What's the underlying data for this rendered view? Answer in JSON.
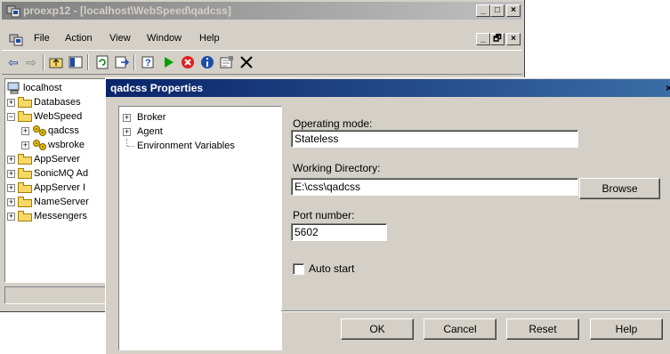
{
  "main_window": {
    "title": "proexp12 - [localhost\\WebSpeed\\qadcss]",
    "menu": [
      "File",
      "Action",
      "View",
      "Window",
      "Help"
    ],
    "caption_buttons": [
      "_",
      "□",
      "×"
    ],
    "mdi_buttons": [
      "_",
      "🗗",
      "×"
    ],
    "toolbar_icons": [
      "back-icon",
      "forward-icon",
      "up-folder-icon",
      "show-hide-tree-icon",
      "refresh-icon",
      "export-icon",
      "help-icon",
      "start-icon",
      "stop-icon",
      "info-icon",
      "properties-icon",
      "delete-icon"
    ]
  },
  "tree": {
    "items": [
      {
        "label": "localhost",
        "icon": "computer-icon"
      },
      {
        "label": "Databases",
        "icon": "folder-icon"
      },
      {
        "label": "WebSpeed",
        "icon": "folder-icon"
      },
      {
        "label": "qadcss",
        "icon": "broker-icon"
      },
      {
        "label": "wsbroke",
        "icon": "broker-icon"
      },
      {
        "label": "AppServer",
        "icon": "folder-icon"
      },
      {
        "label": "SonicMQ Ad",
        "icon": "folder-icon"
      },
      {
        "label": "AppServer I",
        "icon": "folder-icon"
      },
      {
        "label": "NameServer",
        "icon": "folder-icon"
      },
      {
        "label": "Messengers",
        "icon": "folder-icon"
      }
    ]
  },
  "dialog": {
    "title": "qadcss Properties",
    "close": "×",
    "tree": [
      "Broker",
      "Agent",
      "Environment Variables"
    ],
    "operating_mode_label": "Operating mode:",
    "operating_mode_value": "Stateless",
    "working_dir_label": "Working Directory:",
    "working_dir_value": "E:\\css\\qadcss",
    "browse_label": "Browse",
    "port_label": "Port number:",
    "port_value": "5602",
    "auto_start_label": "Auto start",
    "auto_start_checked": false,
    "buttons": {
      "ok": "OK",
      "cancel": "Cancel",
      "reset": "Reset",
      "help": "Help"
    }
  }
}
